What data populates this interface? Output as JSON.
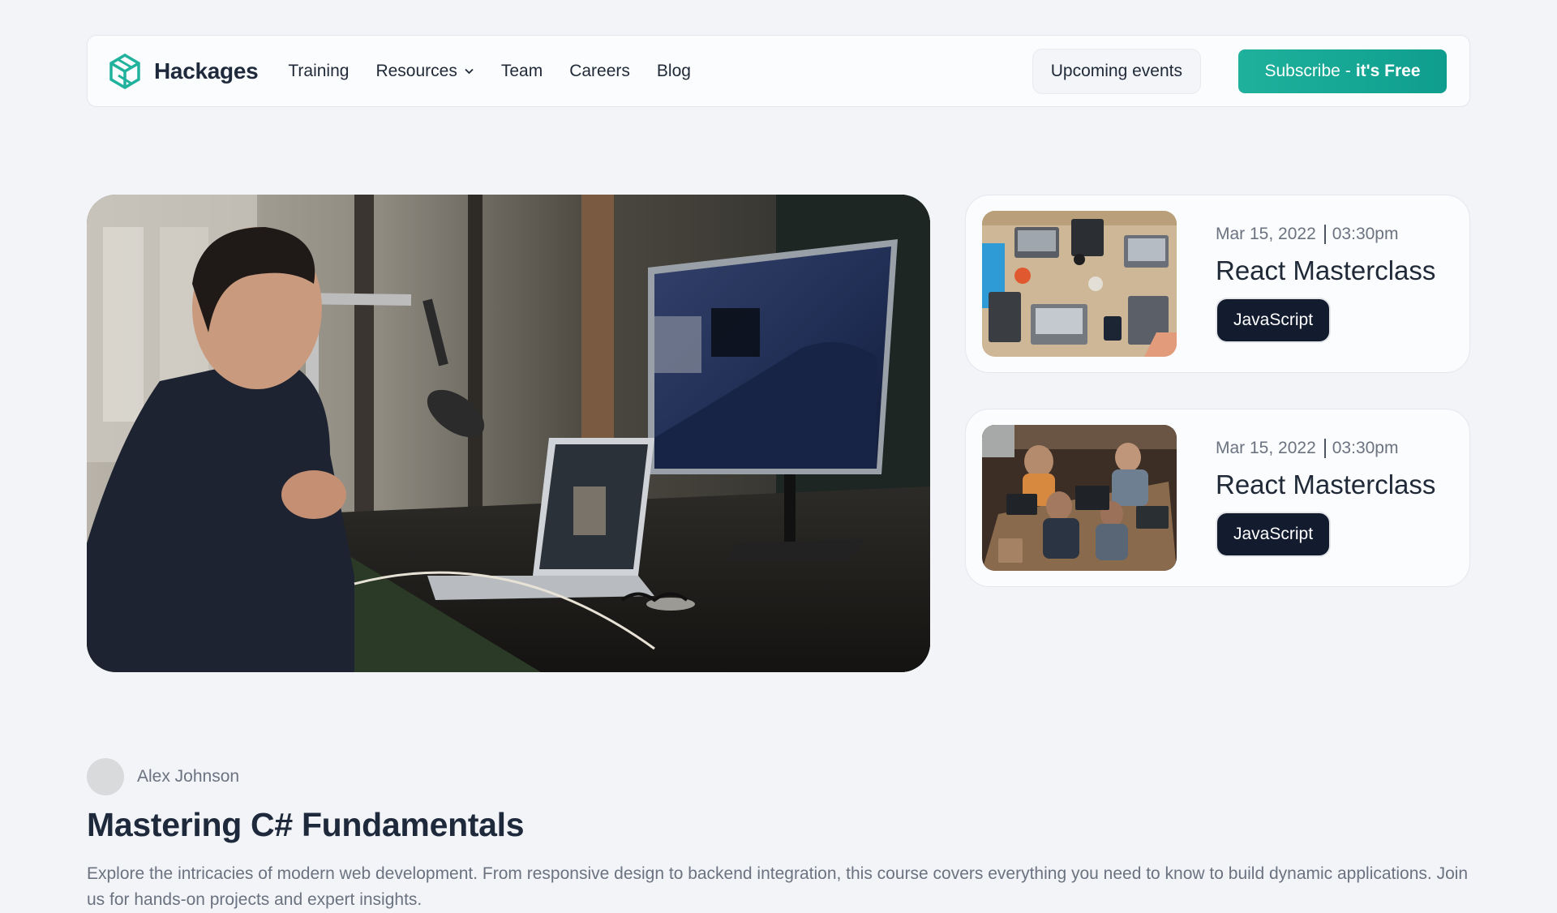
{
  "nav": {
    "brand": "Hackages",
    "links": [
      {
        "label": "Training"
      },
      {
        "label": "Resources",
        "has_dropdown": true
      },
      {
        "label": "Team"
      },
      {
        "label": "Careers"
      },
      {
        "label": "Blog"
      }
    ],
    "upcoming_label": "Upcoming events",
    "subscribe_label": "Subscribe",
    "subscribe_dash": "-",
    "subscribe_strong": "it's Free"
  },
  "events": [
    {
      "date": "Mar 15, 2022",
      "time": "03:30pm",
      "title": "React Masterclass",
      "tag": "JavaScript"
    },
    {
      "date": "Mar 15, 2022",
      "time": "03:30pm",
      "title": "React Masterclass",
      "tag": "JavaScript"
    }
  ],
  "article": {
    "author": "Alex Johnson",
    "title": "Mastering C# Fundamentals",
    "description": "Explore the intricacies of modern web development. From responsive design to backend integration, this course covers everything you need to know to build dynamic applications. Join us for hands-on projects and expert insights."
  },
  "colors": {
    "brand_accent": "#1fb19c",
    "tag_bg": "#131b2e",
    "page_bg": "#f2f4f8"
  },
  "icons": {
    "logo": "hackages-logo-icon",
    "dropdown": "chevron-down-icon"
  }
}
